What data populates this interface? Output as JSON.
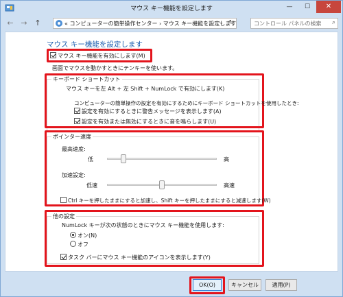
{
  "window": {
    "title": "マウス キー機能を設定します",
    "controls": {
      "minimize": "—",
      "maximize": "☐",
      "close": "✕"
    }
  },
  "nav": {
    "back": "←",
    "forward": "→",
    "up": "↑",
    "address_prefix": "«",
    "breadcrumb": [
      "コンピューターの簡単操作センター",
      "マウス キー機能を設定します"
    ],
    "breadcrumb_sep": "›",
    "search_placeholder": "コントロール パネルの検索"
  },
  "page": {
    "heading": "マウス キー機能を設定します",
    "enable_mouse_keys": {
      "label": "マウス キー機能を有効にします(M)",
      "checked": true
    },
    "enable_description": "画面でマウスを動かすときにテンキーを使います。"
  },
  "keyboard_shortcut": {
    "legend": "キーボード ショートカット",
    "shortcut_desc": "マウス キーを左 Alt + 左 Shift + NumLock で有効にします(K)",
    "shortcut_intro": "コンピューターの簡単操作の設定を有効にするためにキーボード ショートカットを使用したとき:",
    "warning": {
      "label": "設定を有効にするときに警告メッセージを表示します(A)",
      "checked": true
    },
    "sound": {
      "label": "設定を有効または無効にするときに音を鳴らします(U)",
      "checked": true
    }
  },
  "pointer_speed": {
    "legend": "ポインター速度",
    "top_speed_label": "最高速度:",
    "top_speed_low": "低",
    "top_speed_high": "高",
    "top_speed_value": 0.15,
    "accel_label": "加速設定:",
    "accel_low": "低速",
    "accel_high": "高速",
    "accel_value": 0.5,
    "ctrl_shift": {
      "label": "Ctrl キーを押したままにすると加速し、Shift キーを押したままにすると減速します(W)",
      "checked": false
    }
  },
  "other": {
    "legend": "他の設定",
    "numlock_desc": "NumLock キーが次の状態のときにマウス キー機能を使用します:",
    "on": {
      "label": "オン(N)",
      "checked": true
    },
    "off": {
      "label": "オフ",
      "checked": false
    },
    "taskbar": {
      "label": "タスク バーにマウス キー機能のアイコンを表示します(Y)",
      "checked": true
    }
  },
  "buttons": {
    "ok": "OK(O)",
    "cancel": "キャンセル",
    "apply": "適用(P)"
  },
  "colors": {
    "highlight": "#e3141c",
    "heading": "#1d5fb0",
    "titlebar": "#cfe0f2"
  }
}
